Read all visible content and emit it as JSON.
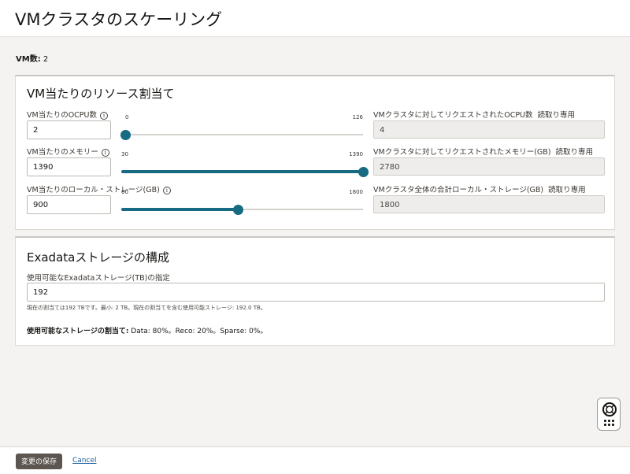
{
  "page": {
    "title": "VMクラスタのスケーリング",
    "vm_count_label": "VM数:",
    "vm_count_value": "2"
  },
  "resources": {
    "title": "VM当たりのリソース割当て",
    "readonly_tag": "読取り専用",
    "ocpu": {
      "label": "VM当たりのOCPU数",
      "value": "2",
      "slider_min": "0",
      "slider_max": "126",
      "slider_fraction": 0.0,
      "total_label": "VMクラスタに対してリクエストされたOCPU数",
      "total_value": "4"
    },
    "memory": {
      "label": "VM当たりのメモリー",
      "value": "1390",
      "slider_min": "30",
      "slider_max": "1390",
      "slider_fraction": 1.0,
      "total_label": "VMクラスタに対してリクエストされたメモリー(GB)",
      "total_value": "2780"
    },
    "storage": {
      "label": "VM当たりのローカル・ストレージ(GB)",
      "value": "900",
      "slider_min": "60",
      "slider_max": "1800",
      "slider_fraction": 0.483,
      "total_label": "VMクラスタ全体の合計ローカル・ストレージ(GB)",
      "total_value": "1800"
    }
  },
  "exadata": {
    "title": "Exadataストレージの構成",
    "field_label": "使用可能なExadataストレージ(TB)の指定",
    "value": "192",
    "help_text": "現在の割当ては192 TBです。最小: 2 TB。現在の割当てを含む使用可能ストレージ: 192.0 TB。",
    "alloc_label": "使用可能なストレージの割当て:",
    "alloc_value": "Data: 80%。Reco: 20%。Sparse: 0%。"
  },
  "footer": {
    "save_label": "変更の保存",
    "cancel_label": "Cancel"
  },
  "icons": {
    "info": "info-icon",
    "help": "lifebuoy-icon"
  },
  "colors": {
    "accent": "#166a82",
    "save_button": "#5c5550",
    "link": "#1a5f9e"
  }
}
